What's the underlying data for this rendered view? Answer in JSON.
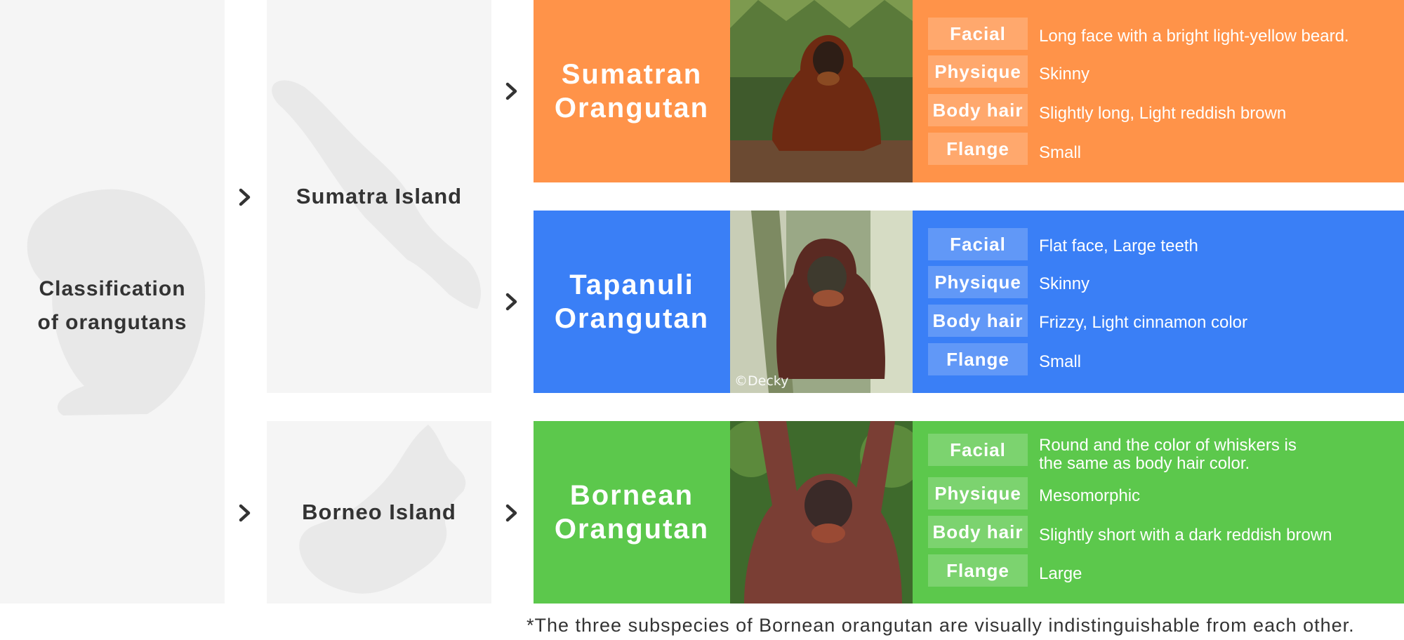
{
  "root": {
    "label": "Classification\nof orangutans"
  },
  "islands": [
    {
      "label": "Sumatra Island"
    },
    {
      "label": "Borneo Island"
    }
  ],
  "species": [
    {
      "name": "Sumatran\nOrangutan",
      "color": "#ff9349",
      "traits": [
        {
          "tag": "Facial",
          "value": "Long face with a bright light-yellow beard."
        },
        {
          "tag": "Physique",
          "value": "Skinny"
        },
        {
          "tag": "Body hair",
          "value": "Slightly long, Light reddish brown"
        },
        {
          "tag": "Flange",
          "value": "Small"
        }
      ]
    },
    {
      "name": "Tapanuli\nOrangutan",
      "color": "#3a7ff6",
      "photo_credit": "©Decky",
      "traits": [
        {
          "tag": "Facial",
          "value": "Flat face, Large teeth"
        },
        {
          "tag": "Physique",
          "value": "Skinny"
        },
        {
          "tag": "Body hair",
          "value": "Frizzy, Light cinnamon color"
        },
        {
          "tag": "Flange",
          "value": "Small"
        }
      ]
    },
    {
      "name": "Bornean\nOrangutan",
      "color": "#5cc84c",
      "traits": [
        {
          "tag": "Facial",
          "value": "Round and the color of whiskers is\nthe same as body hair color."
        },
        {
          "tag": "Physique",
          "value": "Mesomorphic"
        },
        {
          "tag": "Body hair",
          "value": "Slightly short with a dark reddish brown"
        },
        {
          "tag": "Flange",
          "value": "Large"
        }
      ]
    }
  ],
  "footnote": "*The three subspecies  of Bornean orangutan are visually indistinguishable from each other.",
  "icons": {
    "arrow": "chevron-right-icon",
    "photos": [
      "sumatran-orangutan-photo",
      "tapanuli-orangutan-photo",
      "bornean-orangutan-photo"
    ]
  }
}
